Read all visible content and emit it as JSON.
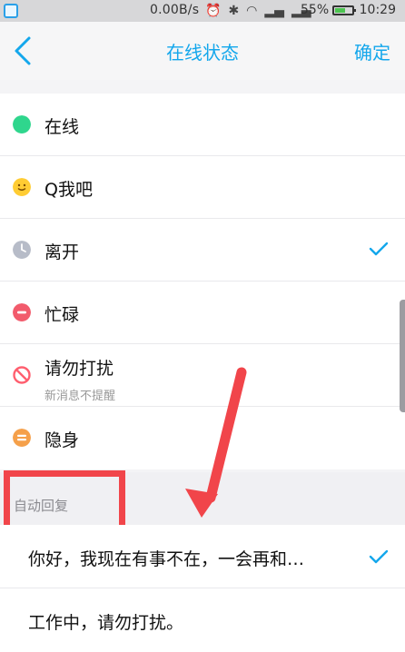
{
  "statusbar": {
    "speed": "0.00B/s",
    "icons": [
      "alarm-icon",
      "bluetooth-icon",
      "wifi-icon",
      "signal-icon",
      "signal-icon"
    ],
    "battery": "55%",
    "battery_level": 0.55,
    "time": "10:29"
  },
  "header": {
    "back_icon": "chevron-left-icon",
    "title": "在线状态",
    "confirm": "确定"
  },
  "statuses": [
    {
      "label": "在线",
      "icon": "online-dot-icon",
      "color": "#2fd68d"
    },
    {
      "label": "Q我吧",
      "icon": "smile-icon",
      "color": "#ffcc33"
    },
    {
      "label": "离开",
      "icon": "clock-icon",
      "color": "#b7bcc8",
      "selected": true
    },
    {
      "label": "忙碌",
      "icon": "busy-icon",
      "color": "#f25b6c"
    },
    {
      "label": "请勿打扰",
      "sub": "新消息不提醒",
      "icon": "dnd-icon",
      "color": "#ff5f6f"
    },
    {
      "label": "隐身",
      "icon": "invisible-icon",
      "color": "#f5a04a"
    }
  ],
  "auto_reply": {
    "title": "自动回复",
    "items": [
      {
        "text": "你好，我现在有事不在，一会再和…",
        "selected": true
      },
      {
        "text": "工作中，请勿打扰。"
      }
    ]
  },
  "colors": {
    "accent": "#14a7ec",
    "highlight": "#f1454a"
  }
}
